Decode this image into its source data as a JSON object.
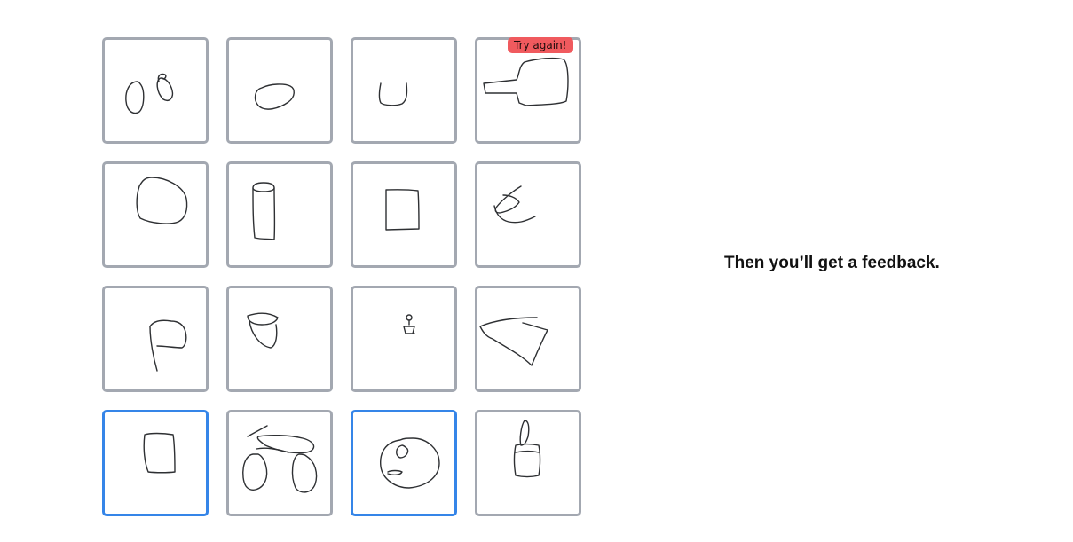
{
  "tiles": [
    {
      "drawing": "glasses-doodle",
      "selected": false
    },
    {
      "drawing": "oval-doodle",
      "selected": false
    },
    {
      "drawing": "cup-doodle",
      "selected": false
    },
    {
      "drawing": "car-shape-doodle",
      "selected": false,
      "badge": "Try again!"
    },
    {
      "drawing": "circle-doodle",
      "selected": false
    },
    {
      "drawing": "cylinder-doodle",
      "selected": false
    },
    {
      "drawing": "square-doodle",
      "selected": false
    },
    {
      "drawing": "hook-doodle",
      "selected": false
    },
    {
      "drawing": "flag-doodle",
      "selected": false
    },
    {
      "drawing": "acorn-doodle",
      "selected": false
    },
    {
      "drawing": "tiny-figure-doodle",
      "selected": false
    },
    {
      "drawing": "sail-doodle",
      "selected": false
    },
    {
      "drawing": "box-doodle",
      "selected": true
    },
    {
      "drawing": "bicycle-doodle",
      "selected": false
    },
    {
      "drawing": "face-doodle",
      "selected": true
    },
    {
      "drawing": "paintbrush-doodle",
      "selected": false
    }
  ],
  "badge_text": "Try again!",
  "feedback_text": "Then you’ll get a feedback.",
  "colors": {
    "tile_border": "#a3a8b1",
    "selected_border": "#3585e8",
    "badge_background": "#f05a5e",
    "stroke": "#2e3033"
  }
}
